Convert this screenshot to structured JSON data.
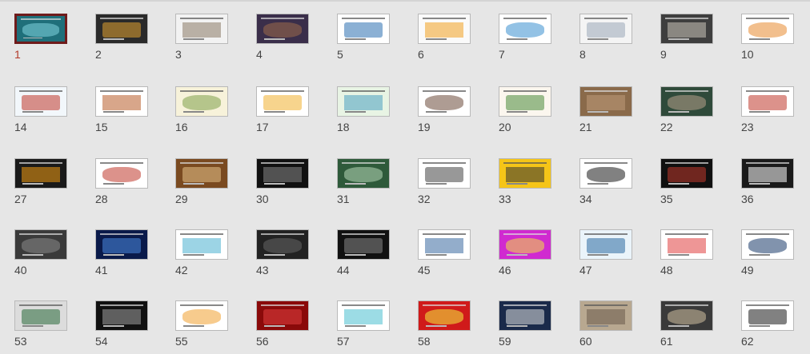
{
  "slides": [
    {
      "number": "1",
      "bg": "#1f6f7a",
      "accent": "#7fd4de",
      "selected": true
    },
    {
      "number": "2",
      "bg": "#2a2a2a",
      "accent": "#e0a030"
    },
    {
      "number": "3",
      "bg": "#f2f2f2",
      "accent": "#8a7a66"
    },
    {
      "number": "4",
      "bg": "#3a2e4a",
      "accent": "#9c6b4a"
    },
    {
      "number": "5",
      "bg": "#ffffff",
      "accent": "#2c6fb0"
    },
    {
      "number": "6",
      "bg": "#fafafa",
      "accent": "#f0a020"
    },
    {
      "number": "7",
      "bg": "#ffffff",
      "accent": "#3b8fcf"
    },
    {
      "number": "8",
      "bg": "#f4f4f4",
      "accent": "#9aa8b8"
    },
    {
      "number": "9",
      "bg": "#3e3e3e",
      "accent": "#c9c2b8"
    },
    {
      "number": "10",
      "bg": "#ffffff",
      "accent": "#e88a30"
    },
    {
      "number": "14",
      "bg": "#f2f7fb",
      "accent": "#c0392b"
    },
    {
      "number": "15",
      "bg": "#ffffff",
      "accent": "#b85c2a"
    },
    {
      "number": "16",
      "bg": "#f7f2da",
      "accent": "#7fa04a"
    },
    {
      "number": "17",
      "bg": "#ffffff",
      "accent": "#f0b030"
    },
    {
      "number": "18",
      "bg": "#e8f4e4",
      "accent": "#4aa0c0"
    },
    {
      "number": "19",
      "bg": "#ffffff",
      "accent": "#6b4a3a"
    },
    {
      "number": "20",
      "bg": "#fbf6ee",
      "accent": "#4a8a3a"
    },
    {
      "number": "21",
      "bg": "#8a6a4a",
      "accent": "#c09a7a"
    },
    {
      "number": "22",
      "bg": "#2f4a3a",
      "accent": "#b6a08a"
    },
    {
      "number": "23",
      "bg": "#ffffff",
      "accent": "#c0392b"
    },
    {
      "number": "27",
      "bg": "#1a1a1a",
      "accent": "#f39c12"
    },
    {
      "number": "28",
      "bg": "#ffffff",
      "accent": "#c0392b"
    },
    {
      "number": "29",
      "bg": "#7a4a20",
      "accent": "#e6c28a"
    },
    {
      "number": "30",
      "bg": "#111111",
      "accent": "#888888"
    },
    {
      "number": "31",
      "bg": "#2e5a3a",
      "accent": "#b8d8b8"
    },
    {
      "number": "32",
      "bg": "#ffffff",
      "accent": "#444444"
    },
    {
      "number": "33",
      "bg": "#f5c518",
      "accent": "#333333"
    },
    {
      "number": "34",
      "bg": "#ffffff",
      "accent": "#1a1a1a"
    },
    {
      "number": "35",
      "bg": "#101010",
      "accent": "#c0392b"
    },
    {
      "number": "36",
      "bg": "#1a1a1a",
      "accent": "#ffffff"
    },
    {
      "number": "40",
      "bg": "#3a3a3a",
      "accent": "#8a8a8a"
    },
    {
      "number": "41",
      "bg": "#0a1a4a",
      "accent": "#4a8ae0"
    },
    {
      "number": "42",
      "bg": "#ffffff",
      "accent": "#4ab0d0"
    },
    {
      "number": "43",
      "bg": "#222222",
      "accent": "#666666"
    },
    {
      "number": "44",
      "bg": "#111111",
      "accent": "#888888"
    },
    {
      "number": "45",
      "bg": "#ffffff",
      "accent": "#3a6aa0"
    },
    {
      "number": "46",
      "bg": "#d02ad0",
      "accent": "#f0e040"
    },
    {
      "number": "47",
      "bg": "#eaf4fa",
      "accent": "#2a6aa0"
    },
    {
      "number": "48",
      "bg": "#ffffff",
      "accent": "#e04040"
    },
    {
      "number": "49",
      "bg": "#ffffff",
      "accent": "#1a3a6a"
    },
    {
      "number": "53",
      "bg": "#dcdcdc",
      "accent": "#2a6a3a"
    },
    {
      "number": "54",
      "bg": "#111111",
      "accent": "#a0a0a0"
    },
    {
      "number": "55",
      "bg": "#ffffff",
      "accent": "#f0a030"
    },
    {
      "number": "56",
      "bg": "#8a0a0a",
      "accent": "#e04040"
    },
    {
      "number": "57",
      "bg": "#ffffff",
      "accent": "#4ac0d0"
    },
    {
      "number": "58",
      "bg": "#d01a1a",
      "accent": "#f0f040"
    },
    {
      "number": "59",
      "bg": "#1a2a4a",
      "accent": "#e0e0e0"
    },
    {
      "number": "60",
      "bg": "#b8a890",
      "accent": "#6a5a4a"
    },
    {
      "number": "61",
      "bg": "#3a3a3a",
      "accent": "#d0c0a0"
    },
    {
      "number": "62",
      "bg": "#ffffff",
      "accent": "#1a1a1a"
    }
  ]
}
